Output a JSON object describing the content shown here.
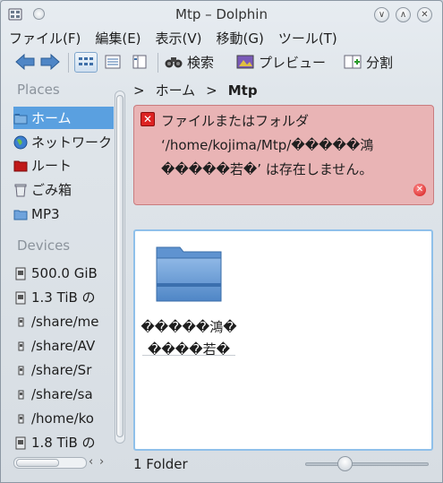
{
  "window": {
    "title": "Mtp – Dolphin"
  },
  "menubar": {
    "items": [
      "ファイル(F)",
      "編集(E)",
      "表示(V)",
      "移動(G)",
      "ツール(T)"
    ]
  },
  "toolbar": {
    "back_icon": "arrow-left-icon",
    "forward_icon": "arrow-right-icon",
    "search_label": "検索",
    "preview_label": "プレビュー",
    "split_label": "分割"
  },
  "sidebar": {
    "places_title": "Places",
    "places": [
      {
        "label": "ホーム",
        "icon": "home-folder-icon",
        "selected": true
      },
      {
        "label": "ネットワーク",
        "icon": "network-globe-icon"
      },
      {
        "label": "ルート",
        "icon": "root-folder-icon"
      },
      {
        "label": "ごみ箱",
        "icon": "trash-icon"
      },
      {
        "label": "MP3",
        "icon": "folder-icon"
      }
    ],
    "devices_title": "Devices",
    "devices": [
      {
        "label": "500.0 GiB"
      },
      {
        "label": "1.3 TiB の"
      },
      {
        "label": "/share/me"
      },
      {
        "label": "/share/AV"
      },
      {
        "label": "/share/Sr"
      },
      {
        "label": "/share/sa"
      },
      {
        "label": "/home/ko"
      },
      {
        "label": "1.8 TiB の"
      }
    ]
  },
  "breadcrumb": {
    "separator": ">",
    "home": "ホーム",
    "current": "Mtp"
  },
  "error": {
    "line1": "ファイルまたはフォルダ",
    "line2": "‘/home/kojima/Mtp/�����鴻",
    "line3": "�����若�’ は存在しません。"
  },
  "view": {
    "folder_name_line1": "�����鴻�",
    "folder_name_line2": "����若�"
  },
  "statusbar": {
    "text": "1 Folder"
  },
  "colors": {
    "accent": "#5aa0e0",
    "error_bg": "#e9b4b5"
  }
}
